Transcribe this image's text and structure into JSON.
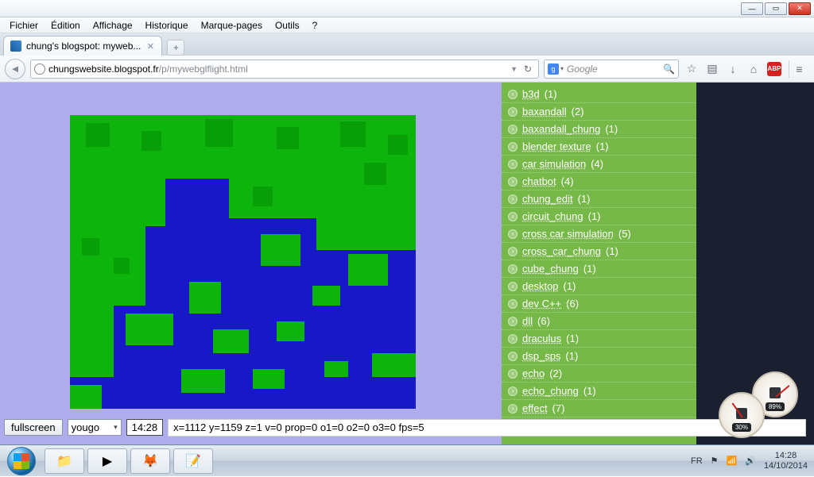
{
  "menu": {
    "file": "Fichier",
    "edit": "Édition",
    "view": "Affichage",
    "history": "Historique",
    "bookmarks": "Marque-pages",
    "tools": "Outils",
    "help": "?"
  },
  "tab": {
    "title": "chung's blogspot: myweb..."
  },
  "url": {
    "host": "chungswebsite.blogspot.fr",
    "path": "/p/mywebglflight.html"
  },
  "search": {
    "placeholder": "Google"
  },
  "status": {
    "fullscreen": "fullscreen",
    "select": "yougo",
    "clock": "14:28",
    "debug": "x=1112 y=1159 z=1 v=0 prop=0 o1=0 o2=0 o3=0 fps=5"
  },
  "tags": [
    {
      "label": "b3d",
      "count": "(1)"
    },
    {
      "label": "baxandall",
      "count": "(2)"
    },
    {
      "label": "baxandall_chung",
      "count": "(1)"
    },
    {
      "label": "blender texture",
      "count": "(1)"
    },
    {
      "label": "car simulation",
      "count": "(4)"
    },
    {
      "label": "chatbot",
      "count": "(4)"
    },
    {
      "label": "chung_edit",
      "count": "(1)"
    },
    {
      "label": "circuit_chung",
      "count": "(1)"
    },
    {
      "label": "cross car simulation",
      "count": "(5)"
    },
    {
      "label": "cross_car_chung",
      "count": "(1)"
    },
    {
      "label": "cube_chung",
      "count": "(1)"
    },
    {
      "label": "desktop",
      "count": "(1)"
    },
    {
      "label": "dev C++",
      "count": "(6)"
    },
    {
      "label": "dll",
      "count": "(6)"
    },
    {
      "label": "draculus",
      "count": "(1)"
    },
    {
      "label": "dsp_sps",
      "count": "(1)"
    },
    {
      "label": "echo",
      "count": "(2)"
    },
    {
      "label": "echo_chung",
      "count": "(1)"
    },
    {
      "label": "effect",
      "count": "(7)"
    }
  ],
  "gauges": {
    "g1": "30%",
    "g2": "89%"
  },
  "tray": {
    "lang": "FR",
    "time": "14:28",
    "date": "14/10/2014"
  }
}
